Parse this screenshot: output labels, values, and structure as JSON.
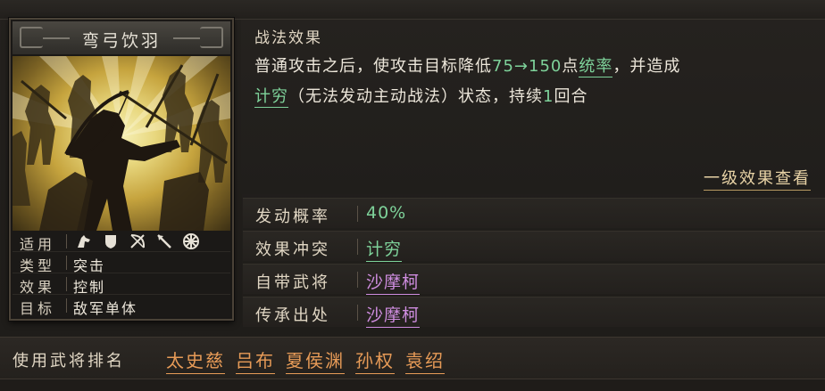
{
  "card": {
    "title": "弯弓饮羽",
    "info": [
      {
        "key": "适用",
        "icons": [
          "cavalry-icon",
          "shield-icon",
          "archer-icon",
          "spear-icon",
          "siege-wheel-icon"
        ]
      },
      {
        "key": "类型",
        "value": "突击"
      },
      {
        "key": "效果",
        "value": "控制"
      },
      {
        "key": "目标",
        "value": "敌军单体"
      }
    ]
  },
  "effect": {
    "heading": "战法效果",
    "line1_pre": "普通攻击之后，使攻击目标降低",
    "line1_num": "75→150",
    "line1_mid": "点",
    "line1_kw": "统率",
    "line1_post": "，并造成",
    "line2_kw": "计穷",
    "line2_mid": "（无法发动主动战法）状态，持续",
    "line2_num": "1",
    "line2_post": "回合",
    "link": "一级效果查看"
  },
  "attributes": [
    {
      "key": "发动概率",
      "value": "40%"
    },
    {
      "key": "效果冲突",
      "value": "计穷"
    },
    {
      "key": "自带武将",
      "value": "沙摩柯"
    },
    {
      "key": "传承出处",
      "value": "沙摩柯"
    }
  ],
  "ranking": {
    "label": "使用武将排名",
    "generals": [
      "太史慈",
      "吕布",
      "夏侯渊",
      "孙权",
      "袁绍"
    ]
  },
  "colors": {
    "green": "#7ed29a",
    "purple": "#cf8de0",
    "orange": "#e79b57",
    "gold": "#e8d3a6"
  }
}
